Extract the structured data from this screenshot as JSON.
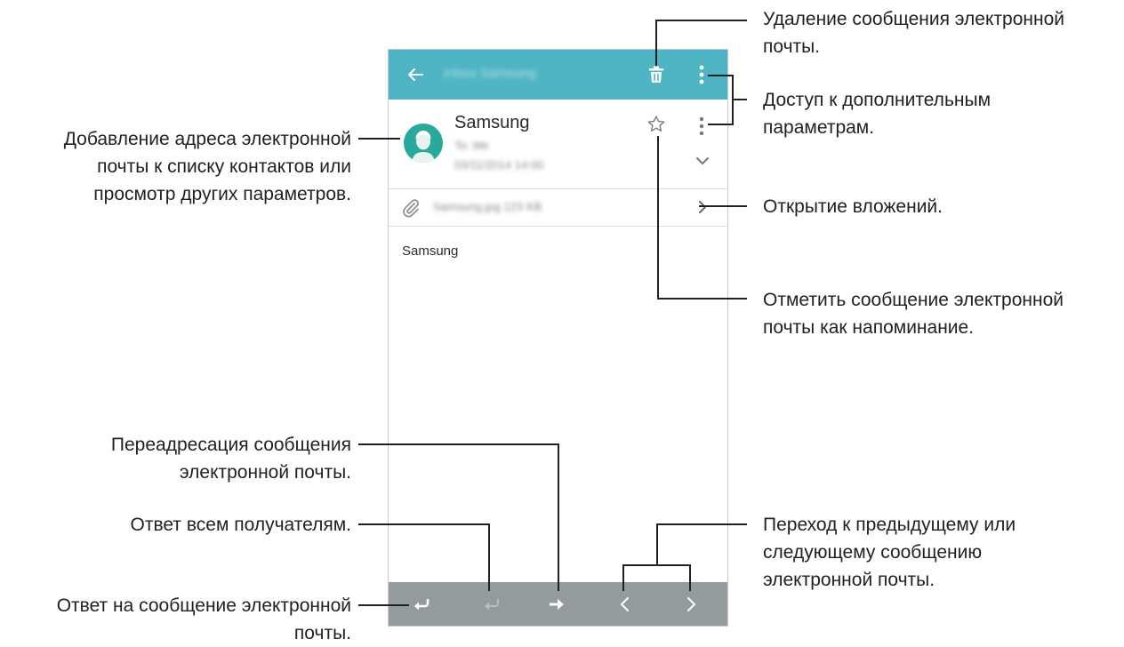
{
  "app_bar": {
    "title": "Inbox Samsung",
    "back_icon": "arrow-left-icon",
    "delete_icon": "trash-icon",
    "more_icon": "more-vert-icon"
  },
  "email": {
    "sender_name": "Samsung",
    "recipient_line": "To: Me",
    "date_line": "03/11/2014 14:00",
    "attachment_name": "Samsung.jpg",
    "attachment_size": "123 KB",
    "body": "Samsung"
  },
  "bottom_bar": {
    "icons": [
      "reply-icon",
      "reply-all-icon",
      "forward-icon",
      "previous-icon",
      "next-icon"
    ]
  },
  "colors": {
    "app_bar": "#4fb5c4",
    "avatar": "#27a99b",
    "bottom_bar": "#949b9e"
  },
  "callouts": {
    "delete": [
      "Удаление сообщения электронной",
      "почты."
    ],
    "more_options": [
      "Доступ к дополнительным",
      "параметрам."
    ],
    "attachments": [
      "Открытие вложений."
    ],
    "reminder": [
      "Отметить сообщение электронной",
      "почты как напоминание."
    ],
    "prev_next": [
      "Переход к предыдущему или",
      "следующему сообщению",
      "электронной почты."
    ],
    "add_contact": [
      "Добавление адреса электронной",
      "почты к списку контактов или",
      "просмотр других параметров."
    ],
    "forward": [
      "Переадресация сообщения",
      "электронной почты."
    ],
    "reply_all": [
      "Ответ всем получателям."
    ],
    "reply": [
      "Ответ на сообщение электронной",
      "почты."
    ]
  }
}
